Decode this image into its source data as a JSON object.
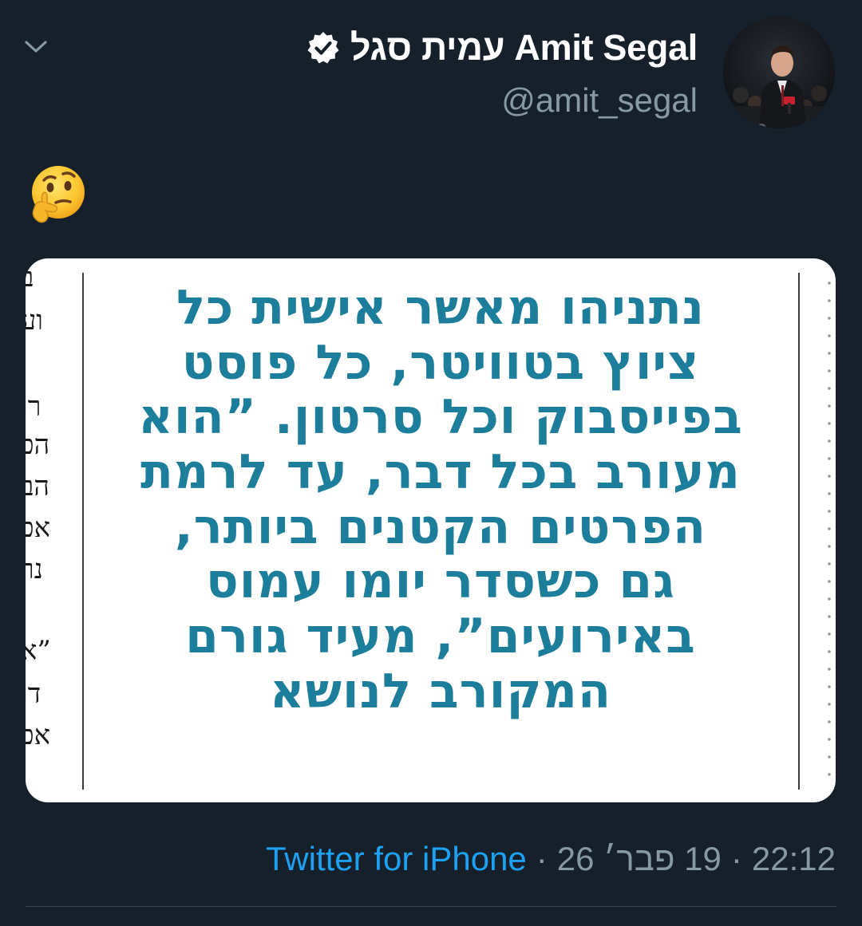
{
  "tweet": {
    "author": {
      "display_name": "עמית סגל Amit Segal",
      "handle": "@amit_segal",
      "verified": true
    },
    "text_emoji": "thinking-face",
    "media": {
      "quote_lines": [
        "נתניהו מאשר אישית כל",
        "ציוץ בטוויטר, כל פוסט",
        "בפייסבוק וכל סרטון. ”הוא",
        "מעורב בכל דבר, עד לרמת",
        "הפרטים הקטנים ביותר,",
        "גם כשסדר יומו עמוס",
        "באירועים”, מעיד גורם",
        "המקורב לנושא"
      ],
      "edge_fragments": [
        "ב",
        "וע",
        "רו",
        "הכ",
        "הב",
        "אכ",
        "נר",
        "”א",
        "דו",
        "אכ"
      ]
    },
    "meta": {
      "source": "Twitter for iPhone",
      "separator": "·",
      "date": "19 פבר׳ 26",
      "time": "22:12"
    }
  },
  "colors": {
    "background": "#15202b",
    "link": "#1da1f2",
    "secondary_text": "#8899a6",
    "quote_text": "#1d7e9c"
  },
  "icons": {
    "caret": "chevron-down-icon",
    "verified": "verified-badge-icon",
    "emoji": "thinking-face-emoji-icon"
  }
}
